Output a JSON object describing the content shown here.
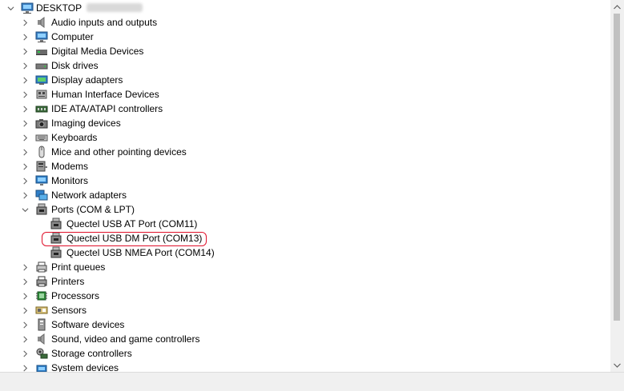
{
  "root": {
    "label": "DESKTOP"
  },
  "items": [
    {
      "label": "Audio inputs and outputs",
      "icon": "speaker-icon"
    },
    {
      "label": "Computer",
      "icon": "computer-icon"
    },
    {
      "label": "Digital Media Devices",
      "icon": "media-device-icon"
    },
    {
      "label": "Disk drives",
      "icon": "disk-drive-icon"
    },
    {
      "label": "Display adapters",
      "icon": "display-adapter-icon"
    },
    {
      "label": "Human Interface Devices",
      "icon": "hid-icon"
    },
    {
      "label": "IDE ATA/ATAPI controllers",
      "icon": "ide-controller-icon"
    },
    {
      "label": "Imaging devices",
      "icon": "camera-icon"
    },
    {
      "label": "Keyboards",
      "icon": "keyboard-icon"
    },
    {
      "label": "Mice and other pointing devices",
      "icon": "mouse-icon"
    },
    {
      "label": "Modems",
      "icon": "modem-icon"
    },
    {
      "label": "Monitors",
      "icon": "monitor-icon"
    },
    {
      "label": "Network adapters",
      "icon": "network-adapter-icon"
    },
    {
      "label": "Ports (COM & LPT)",
      "icon": "port-icon",
      "expanded": true,
      "children": [
        {
          "label": "Quectel USB AT Port (COM11)",
          "icon": "port-icon"
        },
        {
          "label": "Quectel USB DM Port (COM13)",
          "icon": "port-icon",
          "highlighted": true
        },
        {
          "label": "Quectel USB NMEA Port (COM14)",
          "icon": "port-icon"
        }
      ]
    },
    {
      "label": "Print queues",
      "icon": "print-queue-icon"
    },
    {
      "label": "Printers",
      "icon": "printer-icon"
    },
    {
      "label": "Processors",
      "icon": "processor-icon"
    },
    {
      "label": "Sensors",
      "icon": "sensor-icon"
    },
    {
      "label": "Software devices",
      "icon": "software-device-icon"
    },
    {
      "label": "Sound, video and game controllers",
      "icon": "sound-controller-icon"
    },
    {
      "label": "Storage controllers",
      "icon": "storage-controller-icon"
    },
    {
      "label": "System devices",
      "icon": "system-devices-icon"
    }
  ],
  "colors": {
    "highlight_border": "#e0102a",
    "chevron": "#606060"
  }
}
